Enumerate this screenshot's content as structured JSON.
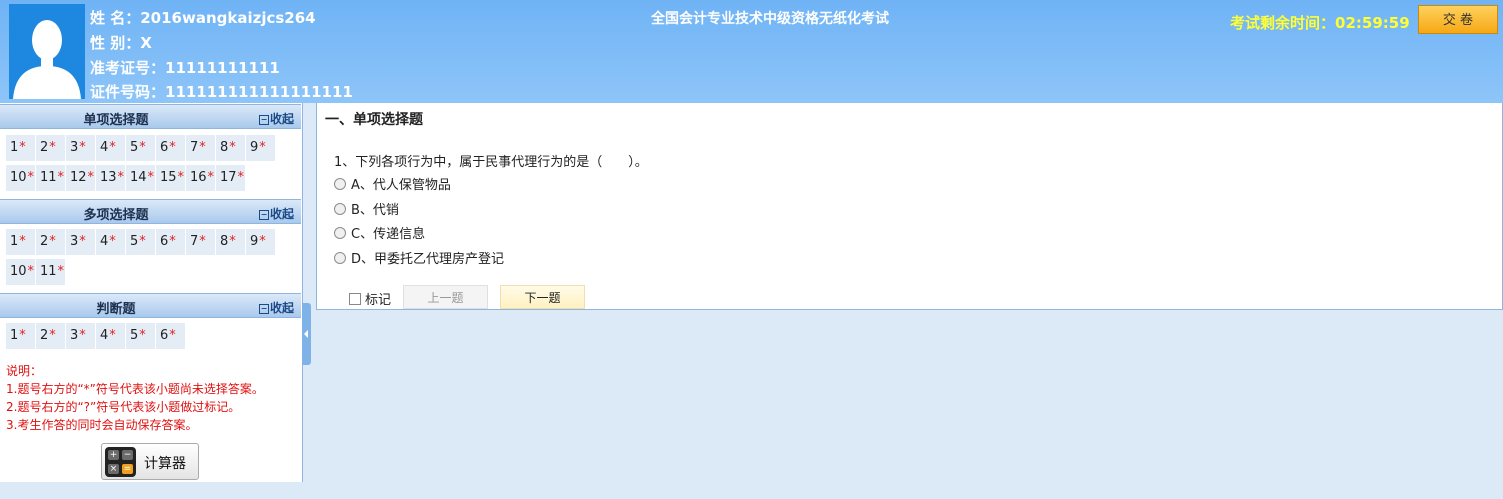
{
  "header": {
    "name_label": "姓 名：2016wangkaizjcs264",
    "gender_label": "性 别：X",
    "exam_no_label": "准考证号：11111111111",
    "id_no_label": "证件号码：111111111111111111",
    "exam_title": "全国会计专业技术中级资格无纸化考试",
    "timer_label": "考试剩余时间：",
    "timer_value": "02:59:59",
    "submit_label": "交 卷"
  },
  "sidebar": {
    "collapse_label": "收起",
    "sections": [
      {
        "title": "单项选择题",
        "questions": [
          "1",
          "2",
          "3",
          "4",
          "5",
          "6",
          "7",
          "8",
          "9",
          "10",
          "11",
          "12",
          "13",
          "14",
          "15",
          "16",
          "17"
        ]
      },
      {
        "title": "多项选择题",
        "questions": [
          "1",
          "2",
          "3",
          "4",
          "5",
          "6",
          "7",
          "8",
          "9",
          "10",
          "11"
        ]
      },
      {
        "title": "判断题",
        "questions": [
          "1",
          "2",
          "3",
          "4",
          "5",
          "6"
        ]
      }
    ],
    "unanswered_mark": "*",
    "notes": [
      "说明：",
      "1.题号右方的“*”符号代表该小题尚未选择答案。",
      "2.题号右方的“?”符号代表该小题做过标记。",
      "3.考生作答的同时会自动保存答案。"
    ],
    "calculator_label": "计算器"
  },
  "main": {
    "section_heading": "一、单项选择题",
    "question": "1、下列各项行为中，属于民事代理行为的是（　　）。",
    "options": [
      "A、代人保管物品",
      "B、代销",
      "C、传递信息",
      "D、甲委托乙代理房产登记"
    ],
    "mark_label": "标记",
    "prev_label": "上一题",
    "next_label": "下一题"
  },
  "colors": {
    "header_bg": "#80bcf7",
    "timer": "#ffff33",
    "submit_bg": "#f6b026",
    "unanswered_star": "#e02020",
    "notes_text": "#e01010"
  }
}
